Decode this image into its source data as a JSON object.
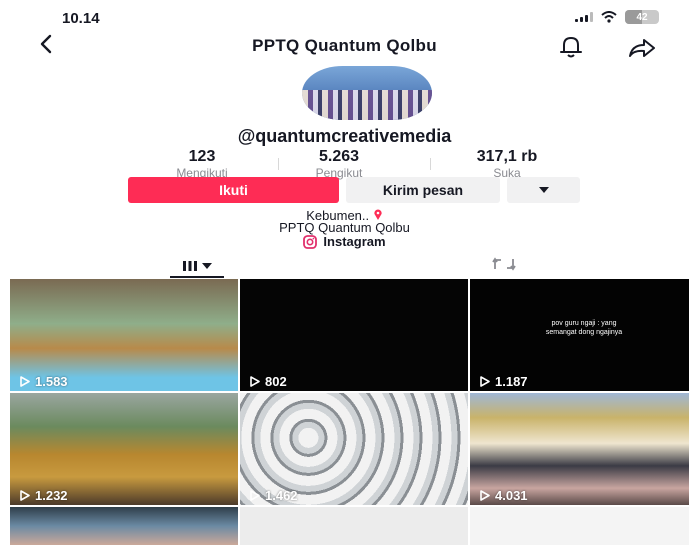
{
  "status_bar": {
    "time": "10.14",
    "battery": "42"
  },
  "nav": {
    "title": "PPTQ Quantum Qolbu"
  },
  "profile": {
    "username": "@quantumcreativemedia",
    "stats": [
      {
        "value": "123",
        "label": "Mengikuti"
      },
      {
        "value": "5.263",
        "label": "Pengikut"
      },
      {
        "value": "317,1 rb",
        "label": "Suka"
      }
    ],
    "follow_label": "Ikuti",
    "message_label": "Kirim pesan",
    "bio_line1": "Kebumen..",
    "bio_line2": "PPTQ Quantum Qolbu",
    "link_label": "Instagram"
  },
  "videos": [
    {
      "views": "1.583"
    },
    {
      "views": "802"
    },
    {
      "views": "1.187",
      "caption_line1": "pov guru ngaji : yang",
      "caption_line2": "semangat dong ngajinya"
    },
    {
      "views": "1.232"
    },
    {
      "views": "1.462"
    },
    {
      "views": "4.031"
    }
  ],
  "colors": {
    "accent": "#fe2c55",
    "text": "#161823",
    "muted": "#8a8b91",
    "button_grey": "#f1f1f2"
  },
  "icons": [
    "back-icon",
    "bell-icon",
    "share-icon",
    "instagram-icon",
    "grid-icon",
    "repost-icon",
    "play-icon",
    "pin-icon"
  ]
}
